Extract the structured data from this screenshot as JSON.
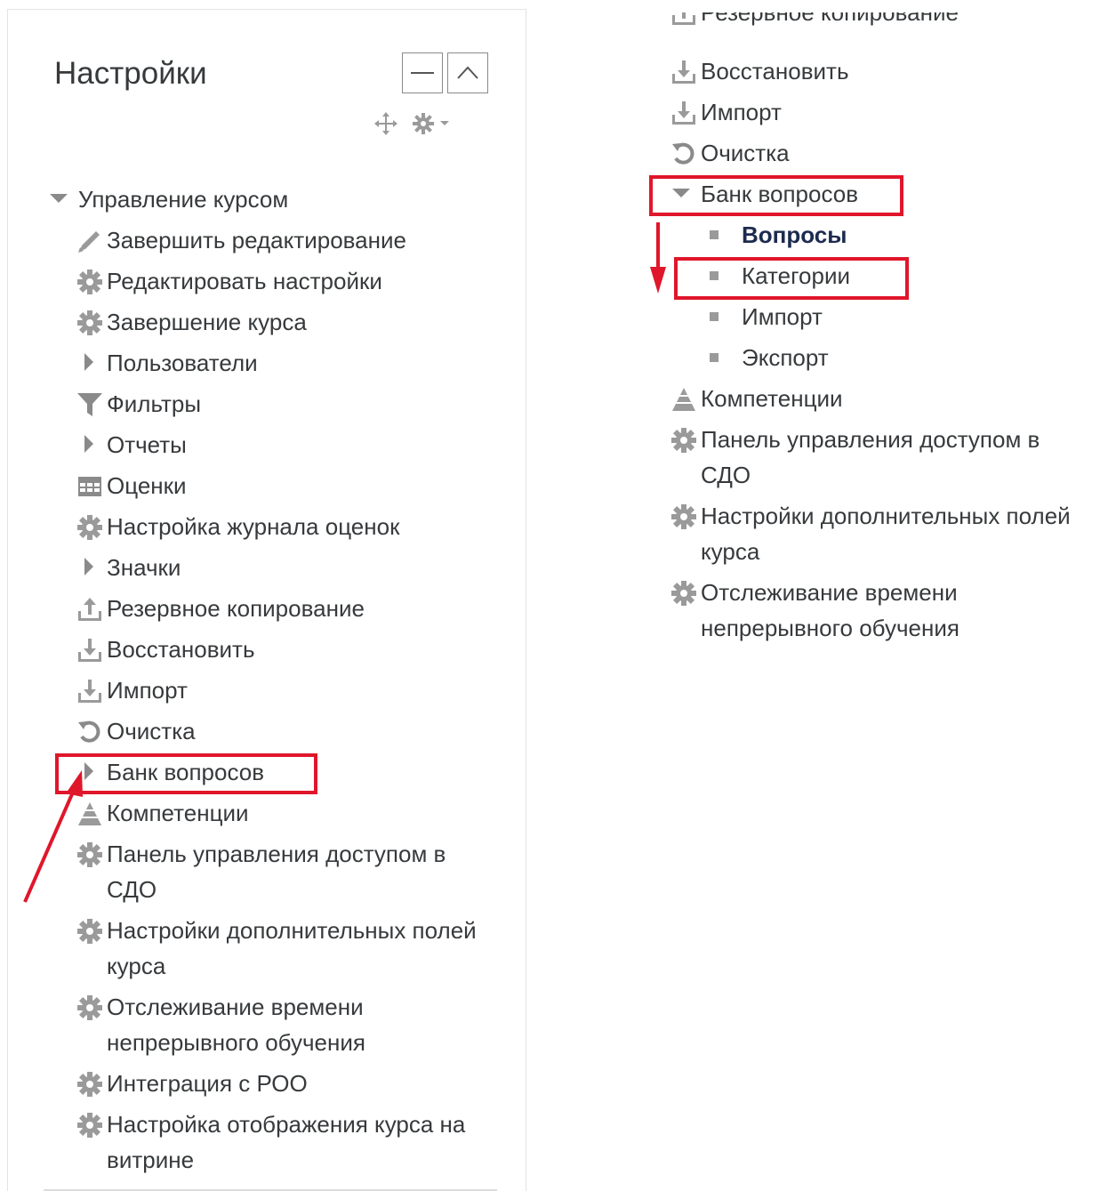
{
  "left_panel": {
    "title": "Настройки",
    "controls": {
      "minimize_icon": "minus-icon",
      "collapse_icon": "chevron-up-icon",
      "move_icon": "move-icon",
      "actions_icon": "gear-dropdown-icon"
    },
    "root_label": "Управление курсом",
    "items": [
      {
        "label": "Завершить редактирование",
        "icon": "pencil-icon"
      },
      {
        "label": "Редактировать настройки",
        "icon": "gear-icon"
      },
      {
        "label": "Завершение курса",
        "icon": "gear-icon"
      },
      {
        "label": "Пользователи",
        "icon": "caret-right-icon"
      },
      {
        "label": "Фильтры",
        "icon": "filter-icon"
      },
      {
        "label": "Отчеты",
        "icon": "caret-right-icon"
      },
      {
        "label": "Оценки",
        "icon": "table-icon"
      },
      {
        "label": "Настройка журнала оценок",
        "icon": "gear-icon"
      },
      {
        "label": "Значки",
        "icon": "caret-right-icon"
      },
      {
        "label": "Резервное копирование",
        "icon": "upload-icon"
      },
      {
        "label": "Восстановить",
        "icon": "download-icon"
      },
      {
        "label": "Импорт",
        "icon": "download-icon"
      },
      {
        "label": "Очистка",
        "icon": "refresh-icon"
      },
      {
        "label": "Банк вопросов",
        "icon": "caret-right-icon"
      },
      {
        "label": "Компетенции",
        "icon": "competency-icon"
      },
      {
        "label": "Панель управления доступом в СДО",
        "icon": "gear-icon"
      },
      {
        "label": "Настройки дополнительных полей курса",
        "icon": "gear-icon"
      },
      {
        "label": "Отслеживание времени непрерывного обучения",
        "icon": "gear-icon"
      },
      {
        "label": "Интеграция с РОО",
        "icon": "gear-icon"
      },
      {
        "label": "Настройка отображения курса на витрине",
        "icon": "gear-icon"
      }
    ]
  },
  "right_panel": {
    "cut_item": "Резервное копирование",
    "items": [
      {
        "label": "Восстановить",
        "icon": "download-icon"
      },
      {
        "label": "Импорт",
        "icon": "download-icon"
      },
      {
        "label": "Очистка",
        "icon": "refresh-icon"
      },
      {
        "label": "Банк вопросов",
        "icon": "caret-down-icon"
      }
    ],
    "question_bank_children": [
      {
        "label": "Вопросы",
        "current": true
      },
      {
        "label": "Категории"
      },
      {
        "label": "Импорт"
      },
      {
        "label": "Экспорт"
      }
    ],
    "after_items": [
      {
        "label": "Компетенции",
        "icon": "competency-icon"
      },
      {
        "label": "Панель управления доступом в СДО",
        "icon": "gear-icon"
      },
      {
        "label": "Настройки дополнительных полей курса",
        "icon": "gear-icon"
      },
      {
        "label": "Отслеживание времени непрерывного обучения",
        "icon": "gear-icon"
      }
    ]
  },
  "annotations": {
    "highlight_color": "#e0162b"
  }
}
